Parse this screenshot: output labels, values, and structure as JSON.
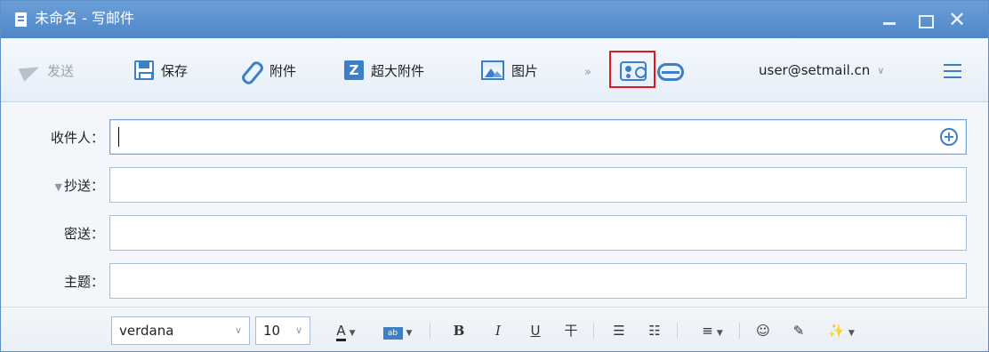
{
  "window": {
    "title": "未命名 - 写邮件",
    "min_symbol": "",
    "max_symbol": "",
    "close_symbol": "✕"
  },
  "toolbar": {
    "send_label": "发送",
    "save_label": "保存",
    "attach_label": "附件",
    "big_attach_label": "超大附件",
    "big_attach_glyph": "Z",
    "image_label": "图片",
    "more_symbol": "»",
    "account": "user@setmail.cn",
    "account_caret": "∨"
  },
  "form": {
    "to_label": "收件人：",
    "cc_label": "抄送：",
    "cc_toggle": "▼",
    "bcc_label": "密送：",
    "subject_label": "主题：",
    "to_value": "",
    "cc_value": "",
    "bcc_value": "",
    "subject_value": "",
    "add_recipient_symbol": "+"
  },
  "format": {
    "font_value": "verdana",
    "size_value": "10",
    "dropdown_symbol": "∨",
    "font_color_glyph": "A",
    "bg_color_glyph": "ab",
    "bold_glyph": "B",
    "italic_glyph": "I",
    "underline_glyph": "U",
    "strike_glyph": "干",
    "bullet_list_glyph": "☰",
    "numbered_list_glyph": "☷",
    "align_glyph": "≡",
    "emoji_glyph": "☺",
    "clear_glyph": "✎",
    "magic_glyph": "✨",
    "small_dd": "▼"
  },
  "icons": {
    "send": "send-icon",
    "save": "save-icon",
    "attach": "paperclip-icon",
    "big_attach": "big-attachment-icon",
    "image": "image-icon",
    "contacts": "contacts-card-icon",
    "sync": "cloud-sync-icon",
    "menu": "hamburger-menu-icon"
  },
  "colors": {
    "title_bar": "#5b91cf",
    "accent": "#3d7fc6",
    "highlight_border": "#e0171d"
  }
}
